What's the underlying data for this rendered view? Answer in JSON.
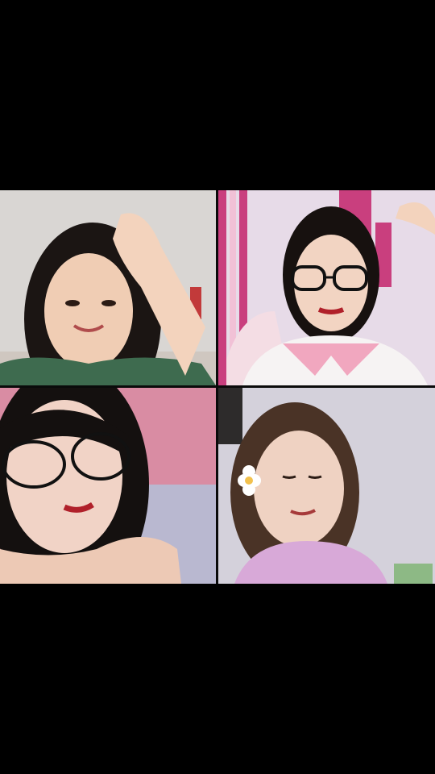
{
  "call": {
    "participants": [
      {
        "id": 1,
        "background": "#d9d6d3"
      },
      {
        "id": 2,
        "background": "#e7dbe8"
      },
      {
        "id": 3,
        "background": "#d98ca3"
      },
      {
        "id": 4,
        "background": "#d4d1db"
      }
    ]
  },
  "colors": {
    "frame": "#000000",
    "divider": "#0a0a0a"
  }
}
